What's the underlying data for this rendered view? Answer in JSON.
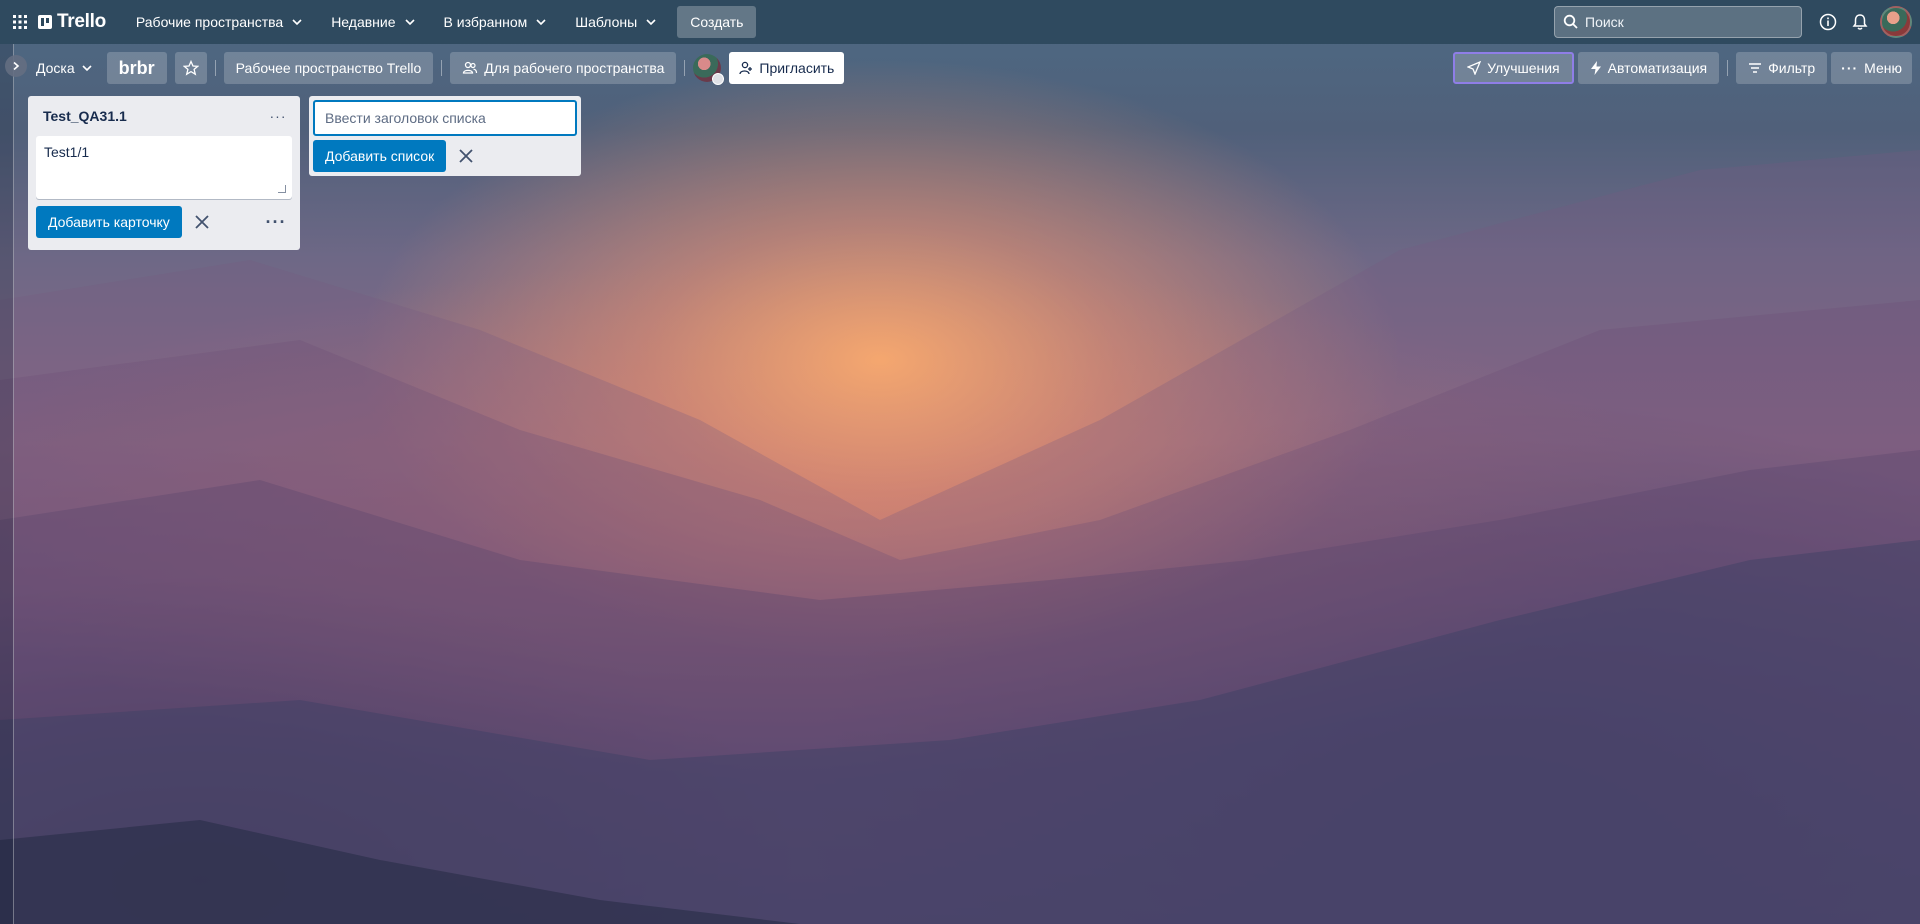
{
  "topnav": {
    "logo": "Trello",
    "menus": [
      {
        "label": "Рабочие пространства"
      },
      {
        "label": "Недавние"
      },
      {
        "label": "В избранном"
      },
      {
        "label": "Шаблоны"
      }
    ],
    "create_label": "Создать",
    "search": {
      "placeholder": "Поиск",
      "value": ""
    }
  },
  "board": {
    "view_label": "Доска",
    "name": "brbr",
    "workspace_label": "Рабочее пространство Trello",
    "visibility_label": "Для рабочего пространства",
    "invite_label": "Пригласить",
    "upgrade_label": "Улучшения",
    "automation_label": "Автоматизация",
    "filter_label": "Фильтр",
    "menu_label": "Меню"
  },
  "lists": [
    {
      "title": "Test_QA31.1",
      "composer_value": "Test1/1",
      "add_card_label": "Добавить карточку"
    }
  ],
  "add_list": {
    "placeholder": "Ввести заголовок списка",
    "add_label": "Добавить список"
  },
  "colors": {
    "primary_button": "#0079bf",
    "list_bg": "#ebecf0",
    "upgrade_border": "#8f7ee7"
  }
}
